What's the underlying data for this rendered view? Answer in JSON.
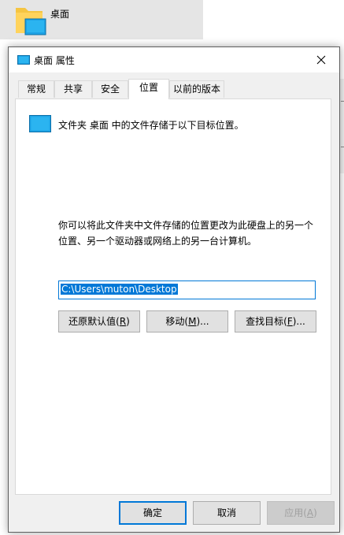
{
  "background": {
    "folder_label": "桌面"
  },
  "dialog": {
    "title": "桌面 属性",
    "tabs": [
      {
        "label": "常规"
      },
      {
        "label": "共享"
      },
      {
        "label": "安全"
      },
      {
        "label": "位置"
      },
      {
        "label": "以前的版本"
      }
    ],
    "active_tab": "位置",
    "description": "文件夹 桌面 中的文件存储于以下目标位置。",
    "info_line1": "你可以将此文件夹中文件存储的位置更改为此硬盘上的另一个",
    "info_line2": "位置、另一个驱动器或网络上的另一台计算机。",
    "path_value": "C:\\Users\\muton\\Desktop",
    "buttons": {
      "restore_prefix": "还原默认值(",
      "restore_key": "R",
      "restore_suffix": ")",
      "move_prefix": "移动(",
      "move_key": "M",
      "move_suffix": ")...",
      "find_prefix": "查找目标(",
      "find_key": "F",
      "find_suffix": ")..."
    },
    "footer": {
      "ok": "确定",
      "cancel": "取消",
      "apply_prefix": "应用(",
      "apply_key": "A",
      "apply_suffix": ")"
    }
  },
  "colors": {
    "accent": "#0078d7",
    "folder_blue": "#1ea3e6",
    "folder_yellow": "#f5c542"
  }
}
